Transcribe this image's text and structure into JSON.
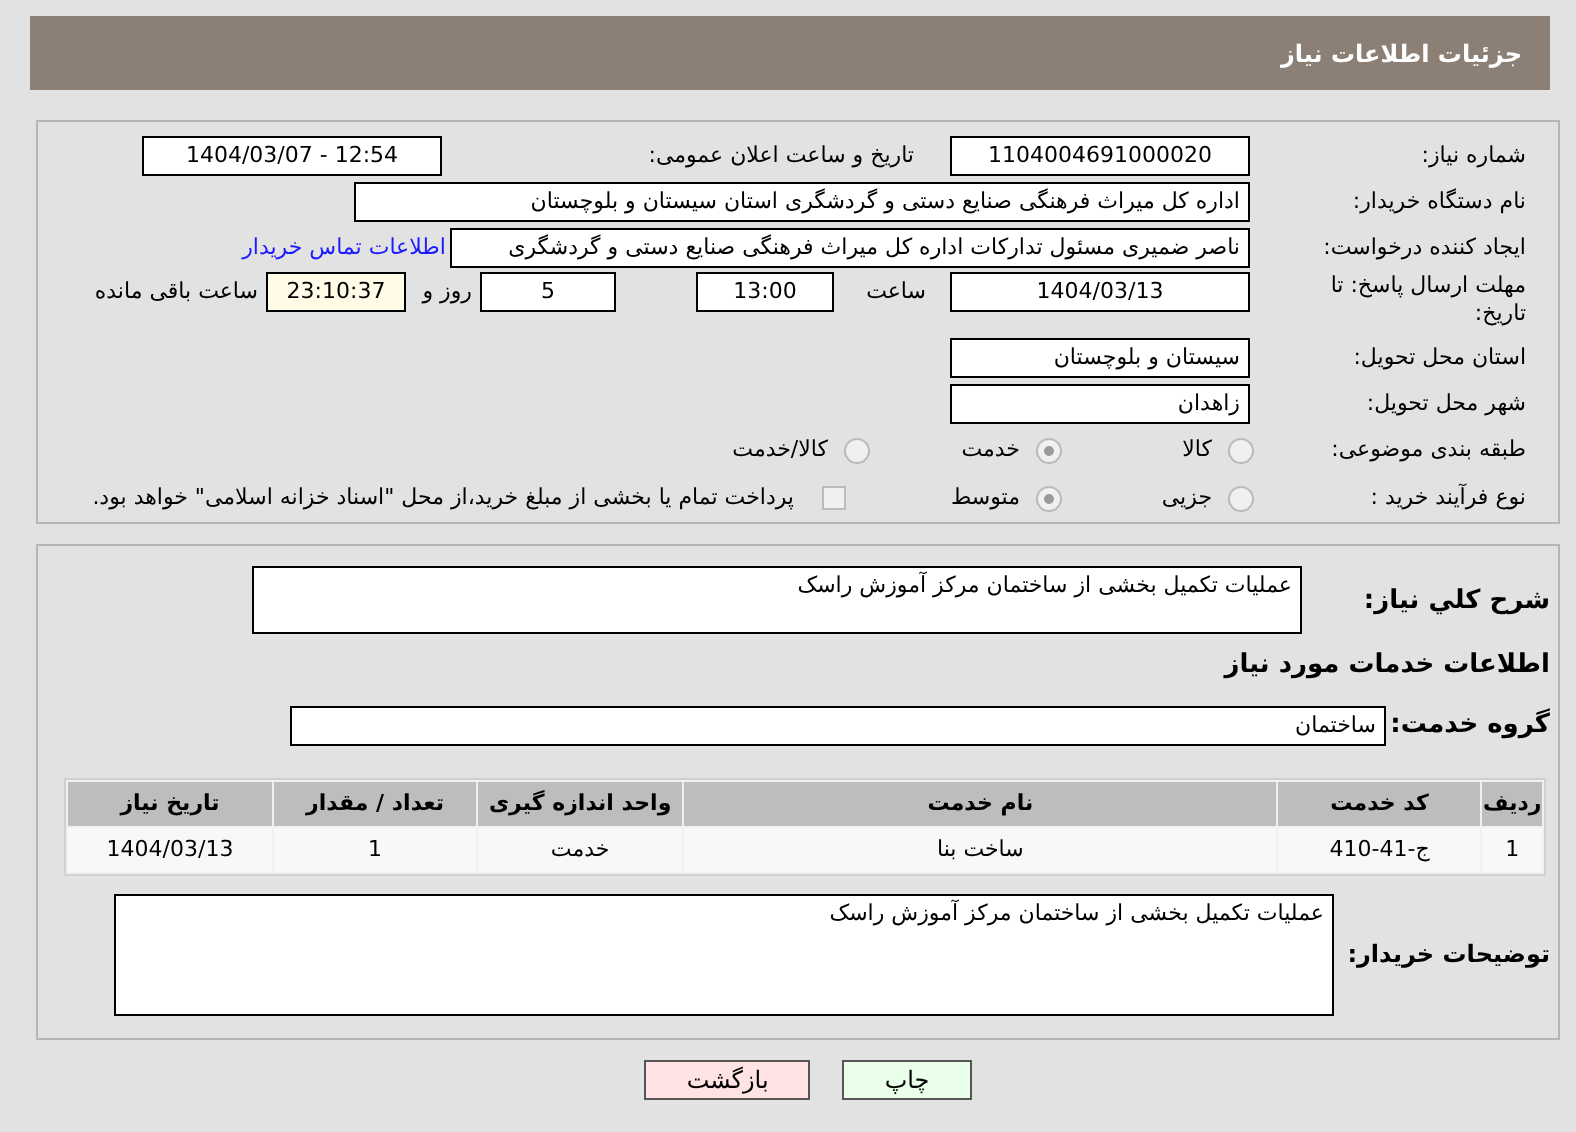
{
  "header": {
    "title": "جزئیات اطلاعات نیاز"
  },
  "details": {
    "need_number": {
      "label": "شماره نیاز:",
      "value": "1104004691000020"
    },
    "announce_date": {
      "label": "تاریخ و ساعت اعلان عمومی:",
      "value": "1404/03/07 - 12:54"
    },
    "buyer_org": {
      "label": "نام دستگاه خریدار:",
      "value": "اداره کل میراث فرهنگی  صنایع دستی و گردشگری استان سیستان و بلوچستان"
    },
    "requester": {
      "label": "ایجاد کننده درخواست:",
      "value": "ناصر ضمیری مسئول تدارکات اداره کل میراث فرهنگی  صنایع دستی و گردشگری",
      "link": "اطلاعات تماس خریدار"
    },
    "deadline": {
      "label": "مهلت ارسال پاسخ: تا تاریخ:",
      "date": "1404/03/13",
      "time_label": "ساعت",
      "time": "13:00",
      "days": "5",
      "days_label": "روز و",
      "remaining": "23:10:37",
      "remaining_label": "ساعت باقی مانده"
    },
    "province": {
      "label": "استان محل تحویل:",
      "value": "سیستان و بلوچستان"
    },
    "city": {
      "label": "شهر محل تحویل:",
      "value": "زاهدان"
    },
    "category": {
      "label": "طبقه بندی موضوعی:",
      "options": [
        {
          "label": "کالا",
          "selected": false
        },
        {
          "label": "خدمت",
          "selected": true
        },
        {
          "label": "کالا/خدمت",
          "selected": false
        }
      ]
    },
    "process": {
      "label": "نوع فرآیند خرید :",
      "options": [
        {
          "label": "جزیی",
          "selected": false
        },
        {
          "label": "متوسط",
          "selected": true
        }
      ],
      "payment": {
        "label": "پرداخت تمام یا بخشی از مبلغ خرید،از محل \"اسناد خزانه اسلامی\" خواهد بود.",
        "checked": false
      }
    }
  },
  "description": {
    "label": "شرح کلي نیاز:",
    "value": "عملیات تکمیل بخشی از ساختمان مرکز آموزش راسک"
  },
  "services_title": "اطلاعات خدمات مورد نیاز",
  "service_group": {
    "label": "گروه خدمت:",
    "value": "ساختمان"
  },
  "table": {
    "columns": [
      "ردیف",
      "کد خدمت",
      "نام خدمت",
      "واحد اندازه گیری",
      "تعداد / مقدار",
      "تاریخ نیاز"
    ],
    "rows": [
      [
        "1",
        "ج-41-410",
        "ساخت بنا",
        "خدمت",
        "1",
        "1404/03/13"
      ]
    ]
  },
  "buyer_notes": {
    "label": "توضیحات خریدار:",
    "value": "عملیات تکمیل بخشی از ساختمان مرکز آموزش راسک"
  },
  "buttons": [
    {
      "label": "چاپ",
      "kind": "print"
    },
    {
      "label": "بازگشت",
      "kind": "back"
    }
  ]
}
